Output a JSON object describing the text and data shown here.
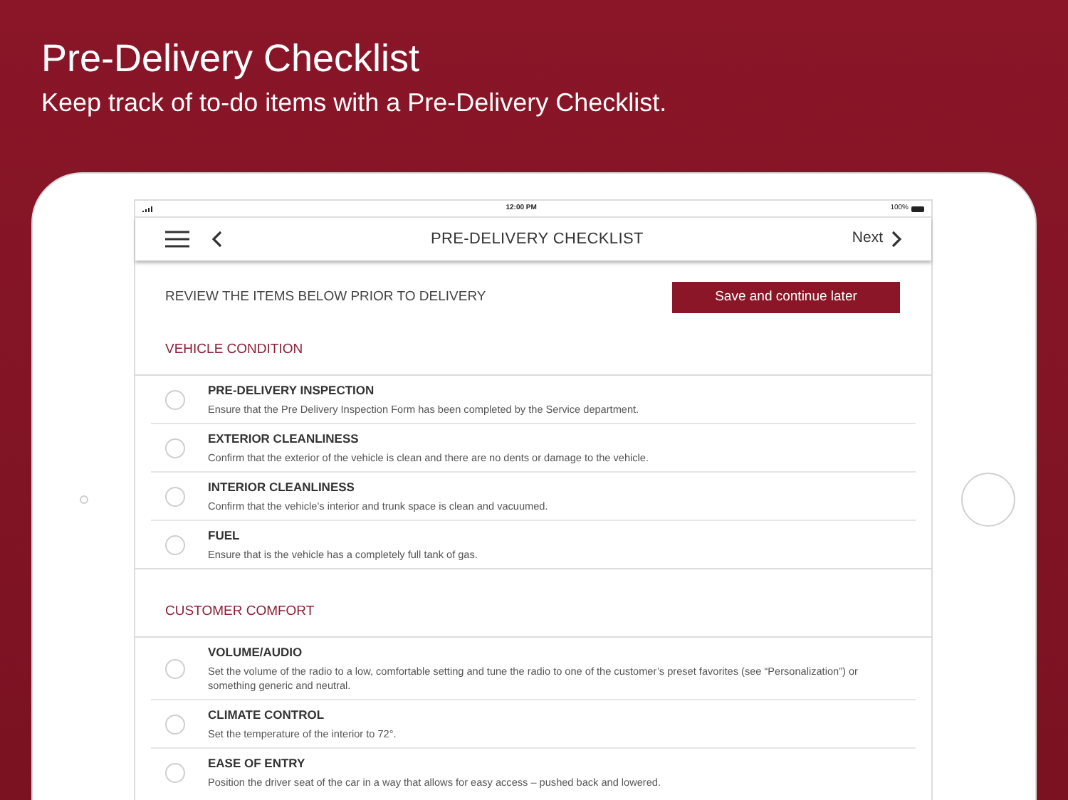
{
  "hero": {
    "title": "Pre-Delivery Checklist",
    "subtitle": "Keep track of to-do items with a Pre-Delivery Checklist."
  },
  "status_bar": {
    "time": "12:00 PM",
    "battery": "100%"
  },
  "nav": {
    "title": "PRE-DELIVERY CHECKLIST",
    "next": "Next"
  },
  "intro": {
    "text": "REVIEW THE ITEMS BELOW PRIOR TO DELIVERY",
    "button": "Save and continue later"
  },
  "sections": [
    {
      "title": "VEHICLE CONDITION",
      "items": [
        {
          "title": "PRE-DELIVERY INSPECTION",
          "description": "Ensure that the Pre Delivery Inspection Form has been completed by the Service department.",
          "checked": false
        },
        {
          "title": "EXTERIOR CLEANLINESS",
          "description": "Confirm that the exterior of the vehicle is clean and there are no dents or damage to the vehicle.",
          "checked": false
        },
        {
          "title": "INTERIOR CLEANLINESS",
          "description": "Confirm that the vehicle’s interior and trunk space is clean and vacuumed.",
          "checked": false
        },
        {
          "title": "FUEL",
          "description": "Ensure that is the vehicle has a completely full tank of gas.",
          "checked": false
        }
      ]
    },
    {
      "title": "CUSTOMER COMFORT",
      "items": [
        {
          "title": "VOLUME/AUDIO",
          "description": "Set the volume of the radio to a low, comfortable setting and tune the radio to one of the customer’s preset favorites (see “Personalization”) or something generic and neutral.",
          "checked": false
        },
        {
          "title": "CLIMATE CONTROL",
          "description": "Set the temperature of the interior to 72°.",
          "checked": false
        },
        {
          "title": "EASE OF ENTRY",
          "description": "Position the driver seat of the car in a way that allows for easy access – pushed back and lowered.",
          "checked": false
        }
      ]
    }
  ]
}
